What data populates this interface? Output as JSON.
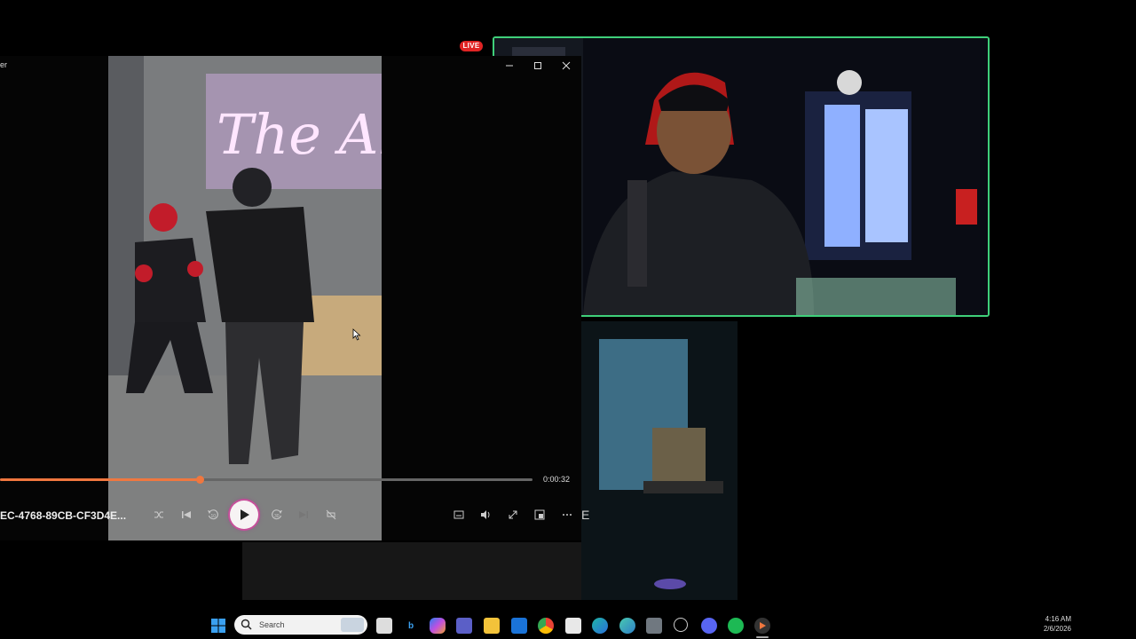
{
  "stream": {
    "live_badge": "LIVE"
  },
  "player": {
    "title_fragment": "er",
    "time_elapsed": "0:00:32",
    "progress": 0.375,
    "filename": "EC-4768-89CB-CF3D4E...",
    "video_sign_text": "The Aka",
    "controls": {
      "shuffle": "shuffle-icon",
      "previous": "previous-icon",
      "rewind": "rewind-10-icon",
      "play": "play-icon",
      "forward": "forward-30-icon",
      "next": "next-icon",
      "repeat": "repeat-off-icon",
      "subtitles": "subtitles-icon",
      "volume": "volume-icon",
      "fullscreen": "fullscreen-icon",
      "mini_view": "mini-view-icon",
      "more": "more-icon"
    },
    "accent_color": "#f0773f"
  },
  "overlay_tile": {
    "letter": "E"
  },
  "cam": {
    "border_color": "#3fd07a"
  },
  "taskbar": {
    "search_placeholder": "Search",
    "clock_time": "4:16 AM",
    "clock_date": "2/6/2026",
    "icons": [
      "windows-start-icon",
      "search-icon",
      "file-explorer-tb-icon",
      "bing-icon",
      "copilot-icon",
      "teams-icon",
      "folder-icon",
      "outlook-icon",
      "chrome-icon",
      "store-icon",
      "edge-icon",
      "edge-dev-icon",
      "calculator-icon",
      "settings-icon",
      "discord-icon",
      "spotify-icon",
      "media-player-icon"
    ]
  }
}
